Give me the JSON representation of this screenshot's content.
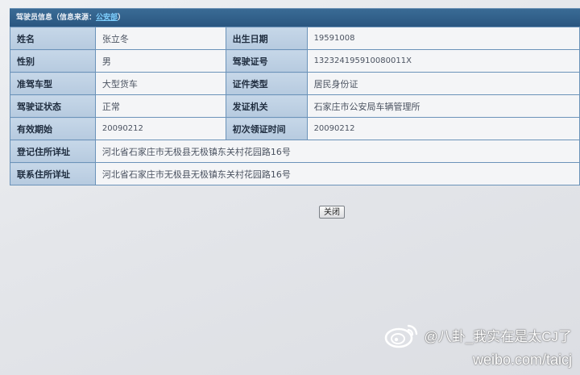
{
  "panel": {
    "title": "驾驶员信息（信息来源：",
    "source_link": "公安部",
    "title_suffix": "）"
  },
  "rows": [
    {
      "label1": "姓名",
      "value1": "张立冬",
      "label2": "出生日期",
      "value2": "19591008"
    },
    {
      "label1": "性别",
      "value1": "男",
      "label2": "驾驶证号",
      "value2": "132324195910080011X"
    },
    {
      "label1": "准驾车型",
      "value1": "大型货车",
      "label2": "证件类型",
      "value2": "居民身份证"
    },
    {
      "label1": "驾驶证状态",
      "value1": "正常",
      "label2": "发证机关",
      "value2": "石家庄市公安局车辆管理所"
    },
    {
      "label1": "有效期始",
      "value1": "20090212",
      "label2": "初次领证时间",
      "value2": "20090212"
    }
  ],
  "address_rows": [
    {
      "label": "登记住所详址",
      "value": "河北省石家庄市无极县无极镇东关村花园路16号"
    },
    {
      "label": "联系住所详址",
      "value": "河北省石家庄市无极县无极镇东关村花园路16号"
    }
  ],
  "close_button": "关闭",
  "watermark": {
    "handle": "@八卦_我实在是太CJ了",
    "url": "weibo.com/taicj",
    "icon": "weibo-logo-icon"
  }
}
